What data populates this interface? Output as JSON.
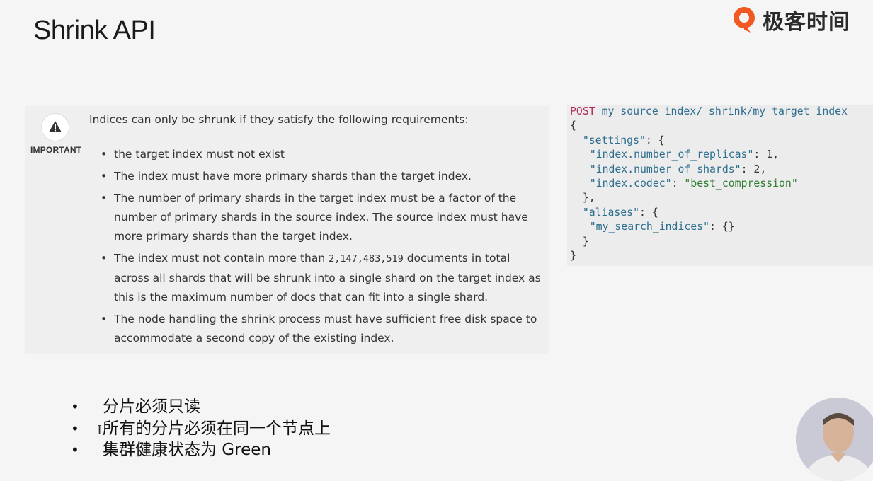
{
  "slide": {
    "title": "Shrink API"
  },
  "brand": {
    "name": "极客时间",
    "icon": "geektime-logo",
    "color": "#f05a22"
  },
  "note": {
    "icon": "warning-icon",
    "label": "IMPORTANT",
    "intro": "Indices can only be shrunk if they satisfy the following requirements:",
    "requirements": [
      {
        "text": "the target index must not exist"
      },
      {
        "text": "The index must have more primary shards than the target index."
      },
      {
        "text": "The number of primary shards in the target index must be a factor of the number of primary shards in the source index. The source index must have more primary shards than the target index."
      },
      {
        "before": "The index must not contain more than ",
        "code": "2,147,483,519",
        "after": " documents in total across all shards that will be shrunk into a single shard on the target index as this is the maximum number of docs that can fit into a single shard."
      },
      {
        "text": "The node handling the shrink process must have sufficient free disk space to accommodate a second copy of the existing index."
      }
    ]
  },
  "code": {
    "method": "POST",
    "path": "my_source_index/_shrink/my_target_index",
    "settings_key": "\"settings\"",
    "replicas_key": "\"index.number_of_replicas\"",
    "replicas_val": "1",
    "shards_key": "\"index.number_of_shards\"",
    "shards_val": "2",
    "codec_key": "\"index.codec\"",
    "codec_val": "\"best_compression\"",
    "aliases_key": "\"aliases\"",
    "alias_name": "\"my_search_indices\"",
    "alias_val": "{}"
  },
  "bullets": [
    "分片必须只读",
    "所有的分片必须在同一个节点上",
    "集群健康状态为 Green"
  ],
  "cursor": "I",
  "presenter": {
    "icon": "presenter-video"
  }
}
